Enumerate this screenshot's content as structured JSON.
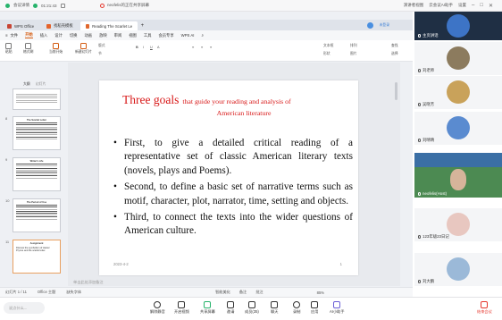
{
  "meeting_top": {
    "security": "会议详情",
    "time": "01:21:43",
    "title": "neofelis的正在共享屏幕",
    "speaker": "演讲者视图",
    "ai": "云会议AI助手",
    "settings": "设置",
    "self_label": "正在讲话"
  },
  "wps": {
    "tabs": [
      {
        "label": "WPS Office"
      },
      {
        "label": "找稻壳模板"
      },
      {
        "label": "Reading The Scarlet Lette"
      }
    ],
    "menu": [
      "文件",
      "开始",
      "插入",
      "设计",
      "切换",
      "动画",
      "放映",
      "审阅",
      "视图",
      "工具",
      "会员专享",
      "WPS AI"
    ],
    "active_menu": "开始",
    "ribbon": {
      "paste": "粘贴",
      "format_painter": "格式刷",
      "from_current": "当前开始",
      "new_slide": "新建幻灯片",
      "layout": "版式",
      "section": "节",
      "textbox": "文本框",
      "shape": "形状",
      "arrange": "排列",
      "picture": "图片",
      "find": "查找",
      "replace": "替换",
      "select": "选择"
    },
    "thumbs": {
      "header": "大纲",
      "header2": "幻灯片",
      "items": [
        {
          "num": "8",
          "title": "The Scarlet Letter"
        },
        {
          "num": "9",
          "title": "Writer's Life"
        },
        {
          "num": "10",
          "title": "The Period of Use"
        },
        {
          "num": "11",
          "title": "Assignment",
          "text": "Discuss the symbolism of Hester Prynne and the scarlet letter."
        }
      ]
    },
    "slide": {
      "title_big": "Three goals",
      "title_small": "that guide your reading and analysis of",
      "title_sub": "American literature",
      "bullets": [
        "First, to give a detailed critical reading of a representative set of classic American literary texts (novels, plays and Poems).",
        "Second, to define a basic set of narrative terms such as motif, character, plot, narrator, time, setting and objects.",
        "Third, to connect the texts into the wider questions of American culture."
      ],
      "date": "2023-4-2",
      "page": "1"
    },
    "notes_placeholder": "单击此处添加备注",
    "status": {
      "slide_count": "幻灯片 1 / 11",
      "theme": "Office 主题",
      "missing_font": "缺失字体",
      "smart": "智能美化",
      "notes": "备注",
      "comments": "批注",
      "zoom": "85%"
    }
  },
  "participants": [
    {
      "name": "主页讲话"
    },
    {
      "name": "刘老师"
    },
    {
      "name": "吴晓芳"
    },
    {
      "name": "刘晴晴"
    },
    {
      "name": "neofelis(Host)"
    },
    {
      "name": "123年级23日记"
    },
    {
      "name": "刘大鹏"
    }
  ],
  "meeting_bottom": {
    "say_placeholder": "说点什么...",
    "buttons": [
      "解除静音",
      "开启视频",
      "共享屏幕",
      "邀请",
      "成员(35)",
      "聊天",
      "录制",
      "应用",
      "AI小助手"
    ],
    "end": "结束会议"
  },
  "colors": {
    "accent": "#d45b10",
    "title_red": "#d81818",
    "end_red": "#e5382e"
  }
}
